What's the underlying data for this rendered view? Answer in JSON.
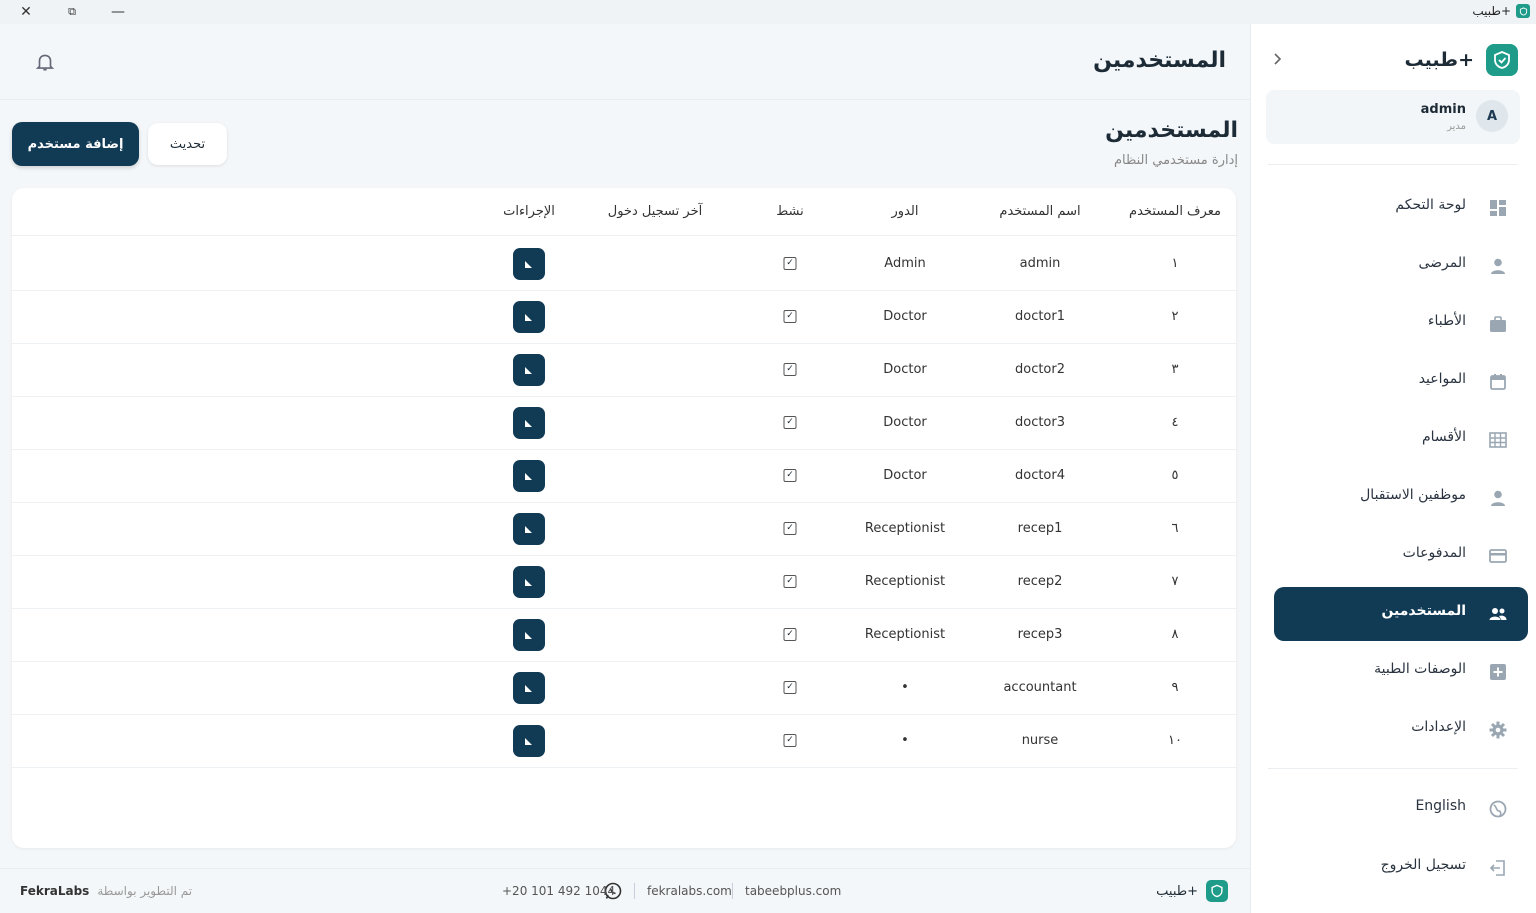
{
  "window": {
    "title": "طبيب+",
    "close": "✕",
    "maximize": "⧉",
    "minimize": "—"
  },
  "sidebar": {
    "brand": "طبيب+",
    "collapse_icon": "chevron-right-icon",
    "user": {
      "initial": "A",
      "name": "admin",
      "role": "مدير"
    },
    "items": [
      {
        "label": "لوحة التحكم",
        "icon": "dashboard-icon"
      },
      {
        "label": "المرضى",
        "icon": "person-icon"
      },
      {
        "label": "الأطباء",
        "icon": "briefcase-icon"
      },
      {
        "label": "المواعيد",
        "icon": "calendar-icon"
      },
      {
        "label": "الأقسام",
        "icon": "departments-icon"
      },
      {
        "label": "موظفين الاستقبال",
        "icon": "person-icon"
      },
      {
        "label": "المدفوعات",
        "icon": "card-icon"
      },
      {
        "label": "المستخدمين",
        "icon": "users-icon",
        "active": true
      },
      {
        "label": "الوصفات الطبية",
        "icon": "plus-box-icon"
      },
      {
        "label": "الإعدادات",
        "icon": "gear-icon"
      }
    ],
    "language": "English",
    "logout": "تسجيل الخروج"
  },
  "header": {
    "title": "المستخدمين",
    "bell_icon": "bell-icon"
  },
  "section": {
    "title": "المستخدمين",
    "subtitle": "إدارة مستخدمي النظام",
    "add_button": "إضافة مستخدم",
    "refresh_button": "تحديث"
  },
  "table": {
    "columns": [
      "معرف المستخدم",
      "اسم المستخدم",
      "الدور",
      "نشط",
      "آخر تسجيل دخول",
      "الإجراءات"
    ],
    "rows": [
      {
        "id": "١",
        "username": "admin",
        "role": "Admin",
        "active": true,
        "last_login": ""
      },
      {
        "id": "٢",
        "username": "doctor1",
        "role": "Doctor",
        "active": true,
        "last_login": ""
      },
      {
        "id": "٣",
        "username": "doctor2",
        "role": "Doctor",
        "active": true,
        "last_login": ""
      },
      {
        "id": "٤",
        "username": "doctor3",
        "role": "Doctor",
        "active": true,
        "last_login": ""
      },
      {
        "id": "٥",
        "username": "doctor4",
        "role": "Doctor",
        "active": true,
        "last_login": ""
      },
      {
        "id": "٦",
        "username": "recep1",
        "role": "Receptionist",
        "active": true,
        "last_login": ""
      },
      {
        "id": "٧",
        "username": "recep2",
        "role": "Receptionist",
        "active": true,
        "last_login": ""
      },
      {
        "id": "٨",
        "username": "recep3",
        "role": "Receptionist",
        "active": true,
        "last_login": ""
      },
      {
        "id": "٩",
        "username": "accountant",
        "role": "•",
        "active": true,
        "last_login": ""
      },
      {
        "id": "١٠",
        "username": "nurse",
        "role": "•",
        "active": true,
        "last_login": ""
      }
    ]
  },
  "footer": {
    "brand": "طبيب+",
    "link1": "tabeebplus.com",
    "link2": "fekralabs.com",
    "phone": "+20 101 492 1044",
    "developed_by_label": "تم التطوير بواسطة",
    "developer": "FekraLabs"
  },
  "colors": {
    "primary": "#113a55",
    "brand": "#1f9b8a",
    "background": "#f4f7f9"
  }
}
